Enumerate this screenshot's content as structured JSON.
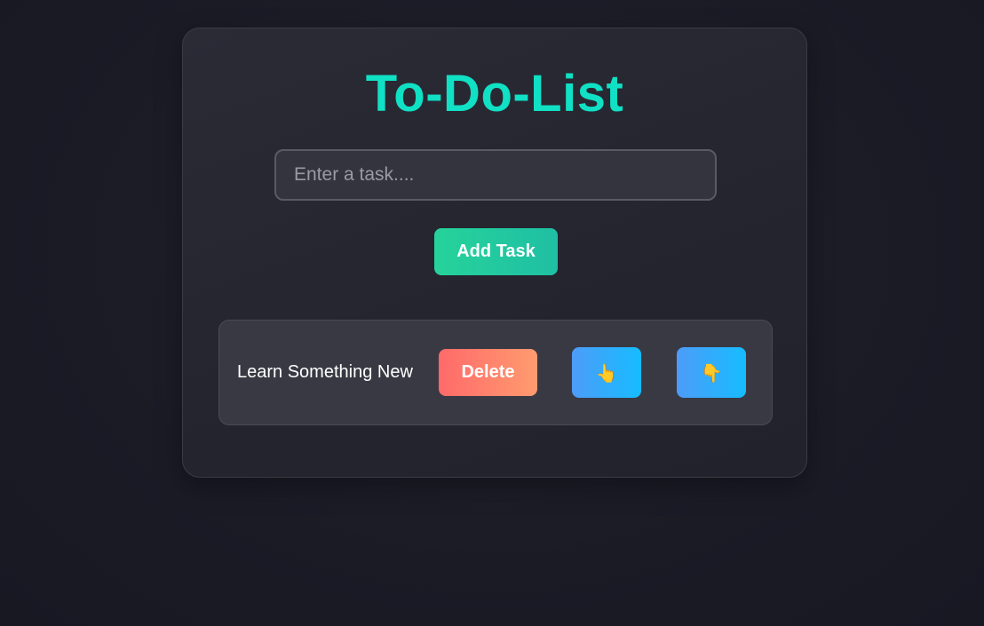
{
  "app": {
    "title": "To-Do-List"
  },
  "input": {
    "placeholder": "Enter a task....",
    "value": ""
  },
  "add_button": {
    "label": "Add Task"
  },
  "tasks": [
    {
      "text": "Learn Something New",
      "delete_label": "Delete",
      "move_up_icon": "👆",
      "move_down_icon": "👇"
    }
  ],
  "colors": {
    "title": "#10e0c4",
    "add_button_gradient": [
      "#26d39a",
      "#1fbfa4"
    ],
    "delete_button_gradient": [
      "#ff6a6a",
      "#ff9b6f"
    ],
    "move_button_gradient": [
      "#4d9cf8",
      "#16bcff"
    ],
    "background": "#1b1b26"
  }
}
